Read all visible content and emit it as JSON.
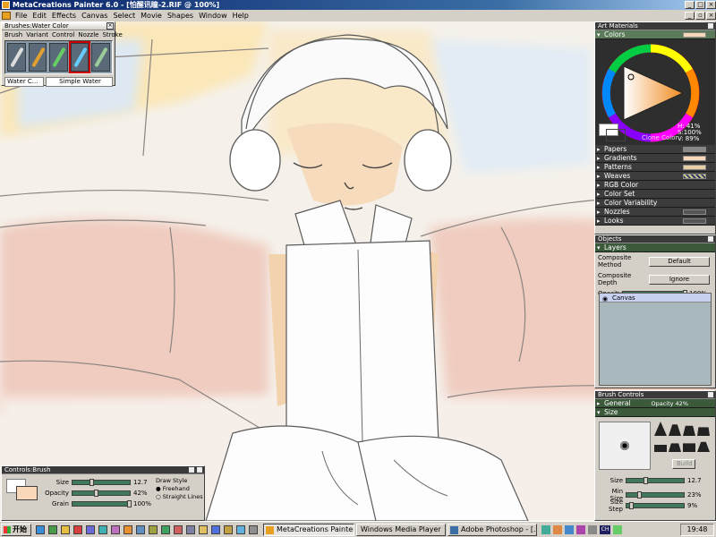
{
  "window": {
    "title": "MetaCreations Painter 6.0 - [怕醒讯瞳-2.RIF @ 100%]"
  },
  "menu": [
    "File",
    "Edit",
    "Effects",
    "Canvas",
    "Select",
    "Movie",
    "Shapes",
    "Window",
    "Help"
  ],
  "brushes_panel": {
    "title": "Brushes:Water Color",
    "menus": [
      "Brush",
      "Variant",
      "Control",
      "Nozzle",
      "Stroke"
    ],
    "category": "Water C...",
    "variant": "Simple Water"
  },
  "art_materials": {
    "title": "Art Materials",
    "colors_label": "Colors",
    "hsv": {
      "h": "H: 41%",
      "s": "S:100%",
      "v": "V: 89%"
    },
    "clone_color_label": "Clone Color",
    "rows": [
      "Papers",
      "Gradients",
      "Patterns",
      "Weaves",
      "RGB Color",
      "Color Set",
      "Color Variability",
      "Nozzles",
      "Looks"
    ],
    "colors": {
      "primary": "#f8d8b8",
      "secondary": "#ffffff"
    }
  },
  "objects_panel": {
    "title": "Objects",
    "section": "Layers",
    "composite_method_label": "Composite Method",
    "composite_method_value": "Default",
    "composite_depth_label": "Composite Depth",
    "composite_depth_value": "Ignore",
    "opacity_label": "Opacity",
    "opacity_value": "100%",
    "opacity_fraction": 1.0,
    "layer_name": "Canvas"
  },
  "brush_controls": {
    "title": "Brush Controls",
    "general_label": "General",
    "general_opacity": "Opacity 42%",
    "size_label": "Size",
    "size_value": "12.7",
    "min_size_label": "Min Size",
    "min_size_value": "23%",
    "size_step_label": "Size Step",
    "size_step_value": "9%",
    "sliders": {
      "size": 0.35,
      "min_size": 0.23,
      "size_step": 0.09
    }
  },
  "controls_brush": {
    "title": "Controls:Brush",
    "size_label": "Size",
    "size_value": "12.7",
    "opacity_label": "Opacity",
    "opacity_value": "42%",
    "grain_label": "Grain",
    "grain_value": "100%",
    "draw_style_label": "Draw Style",
    "freehand_label": "Freehand",
    "straight_label": "Straight Lines",
    "sliders": {
      "size": 0.35,
      "opacity": 0.42,
      "grain": 1.0
    }
  },
  "taskbar": {
    "start_label": "开始",
    "tasks": [
      "MetaCreations Painter ...",
      "Windows Media Player",
      "Adobe Photoshop - [..."
    ],
    "clock": "19:48",
    "ime": "CH"
  }
}
